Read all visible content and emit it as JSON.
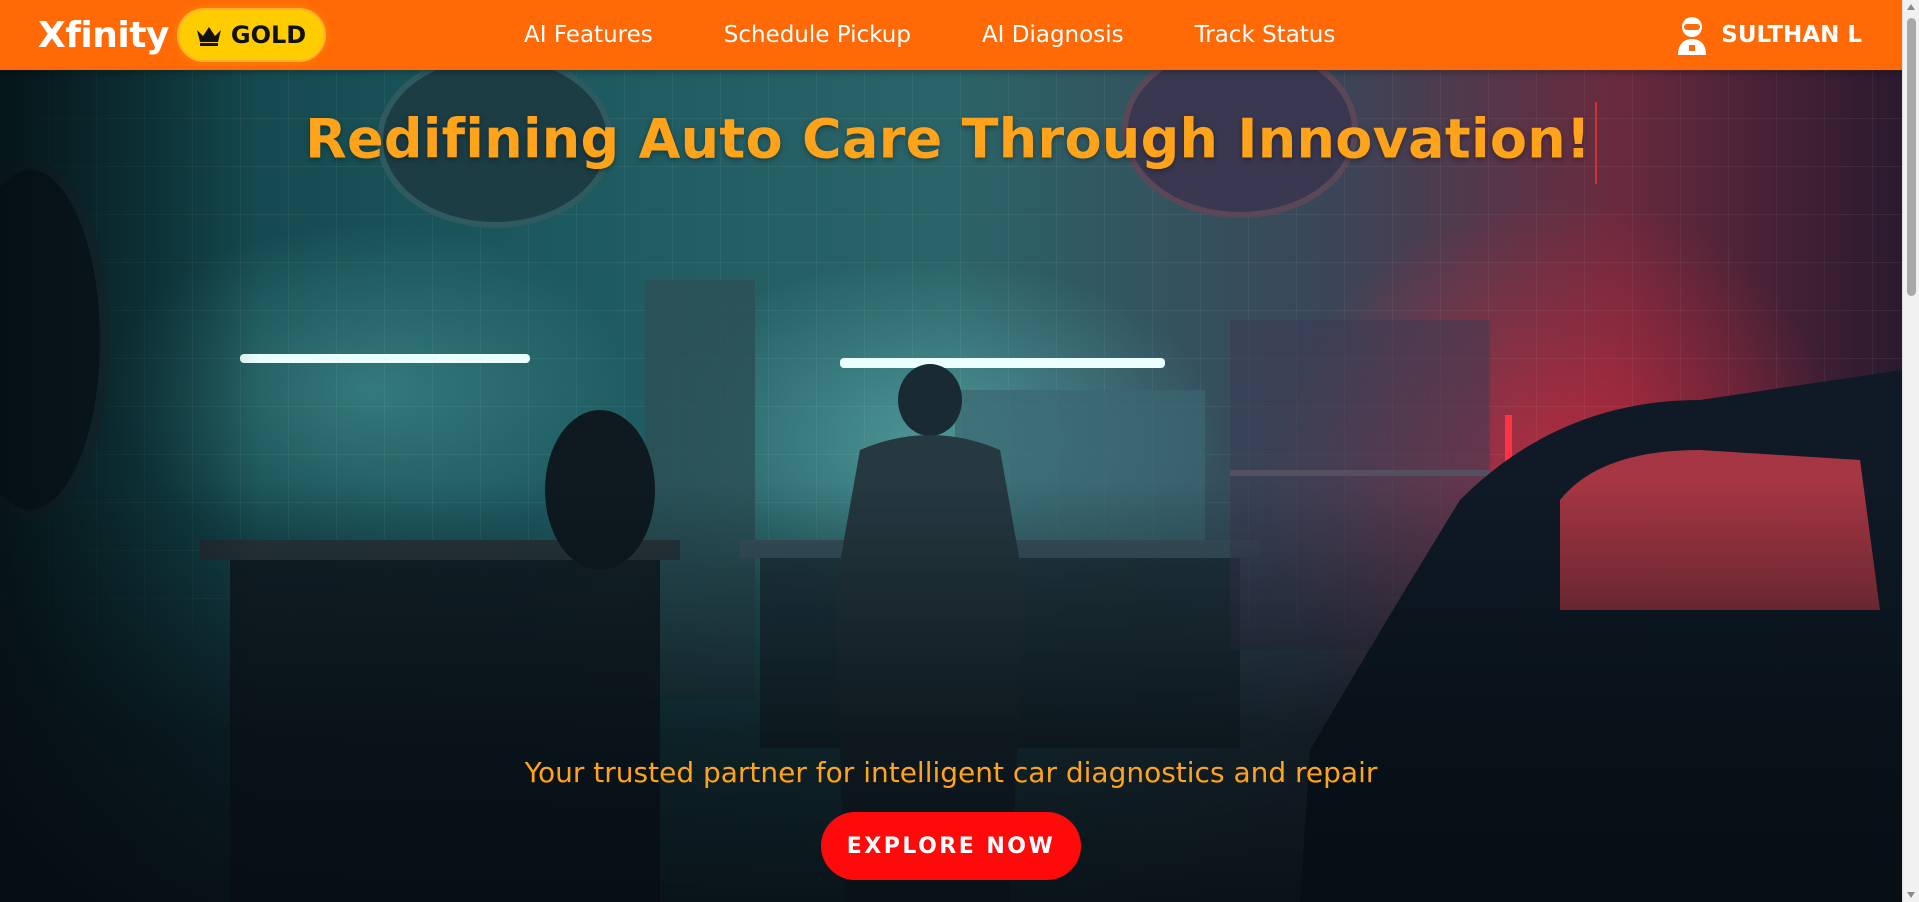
{
  "navbar": {
    "brand": "Xfinity",
    "tier": {
      "icon": "crown-icon",
      "label": "GOLD"
    },
    "links": [
      {
        "label": "AI Features"
      },
      {
        "label": "Schedule Pickup"
      },
      {
        "label": "AI Diagnosis"
      },
      {
        "label": "Track Status"
      }
    ],
    "user": {
      "icon": "user-avatar-icon",
      "name": "SULTHAN L"
    }
  },
  "hero": {
    "title": "Redifining Auto Care Through Innovation!",
    "subtitle": "Your trusted partner for intelligent car diagnostics and repair",
    "cta_label": "EXPLORE NOW",
    "background": "garage-photo"
  },
  "colors": {
    "nav_bg": "#ff6a06",
    "badge_bg": "#ffcc00",
    "accent_text": "#ffa31a",
    "cta_bg": "#ff0a0a"
  }
}
